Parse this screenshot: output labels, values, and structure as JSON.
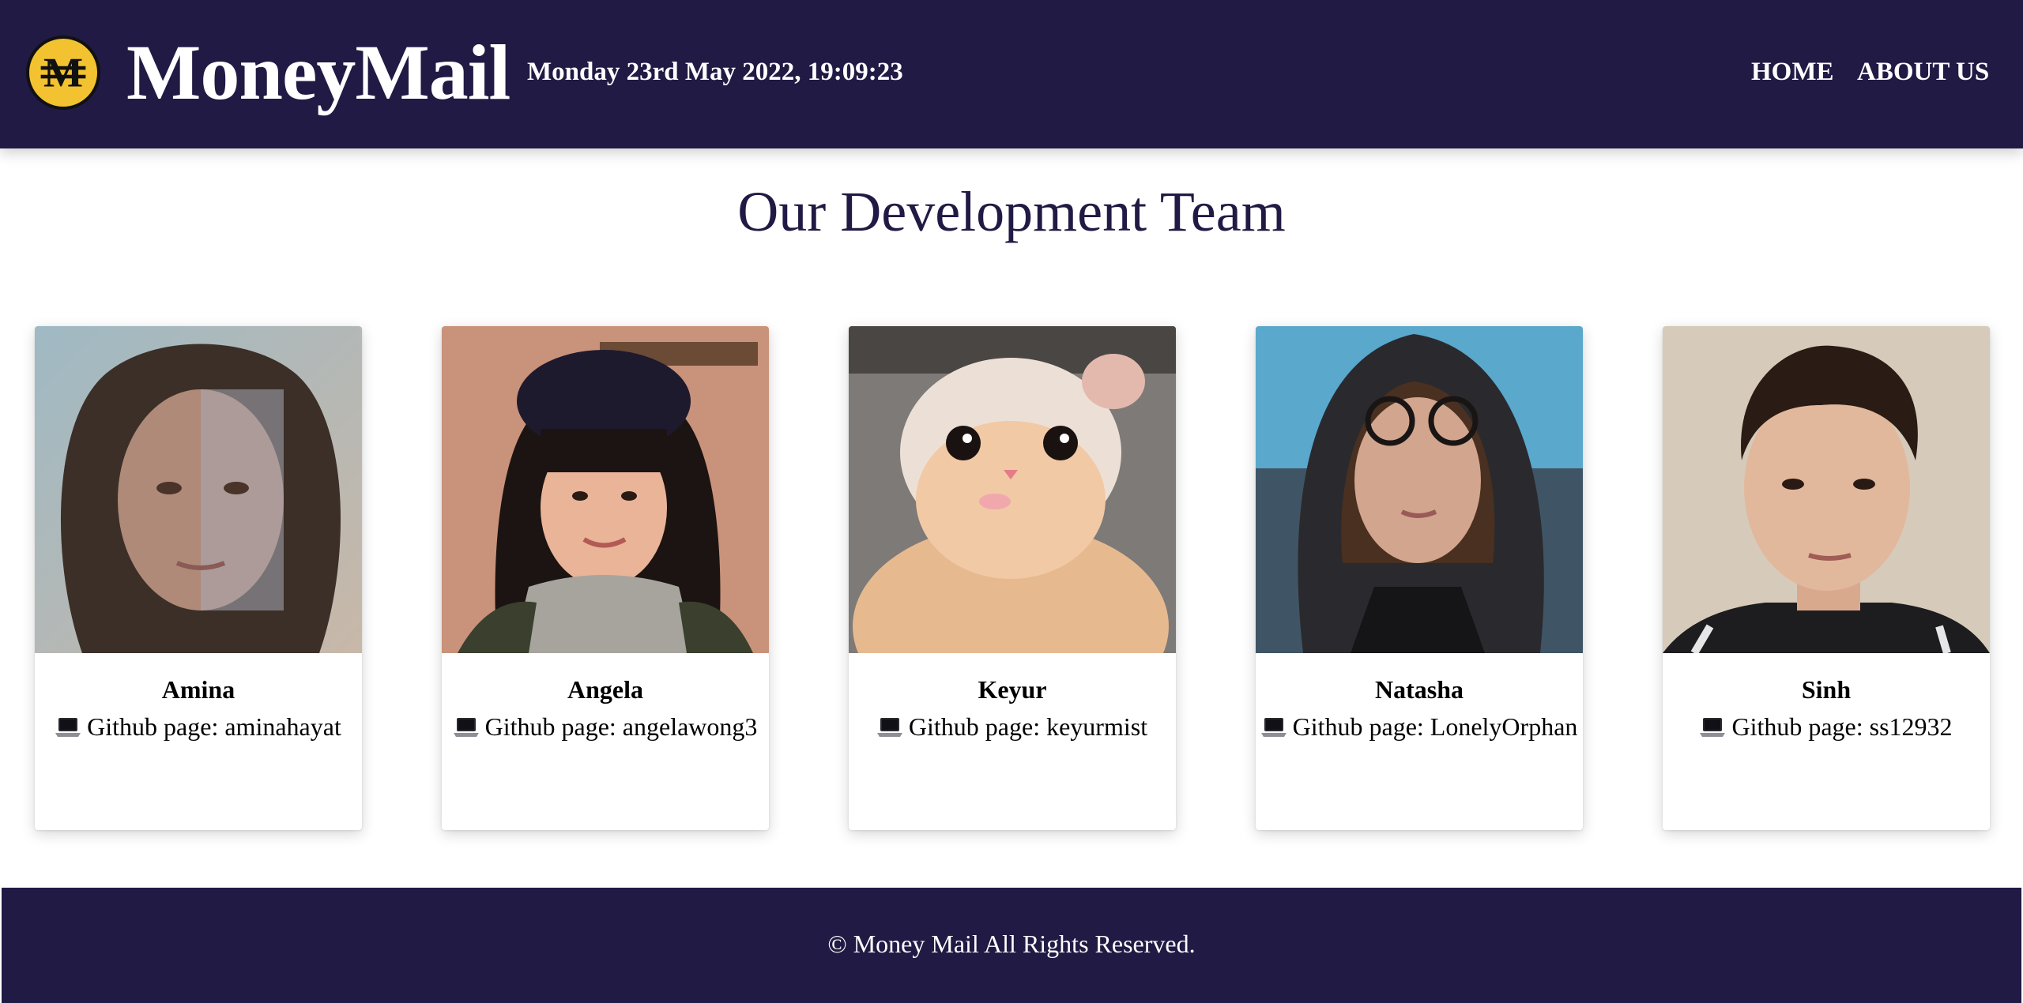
{
  "header": {
    "brand": "MoneyMail",
    "datetime": "Monday 23rd May 2022, 19:09:23",
    "logo_icon": "moneymail-coin-logo",
    "nav": [
      {
        "label": "HOME"
      },
      {
        "label": "ABOUT US"
      }
    ]
  },
  "main": {
    "title": "Our Development Team",
    "github_prefix": "Github page: ",
    "github_icon": "laptop-icon",
    "team": [
      {
        "name": "Amina",
        "github": "aminahayat"
      },
      {
        "name": "Angela",
        "github": "angelawong3"
      },
      {
        "name": "Keyur",
        "github": "keyurmist"
      },
      {
        "name": "Natasha",
        "github": "LonelyOrphan"
      },
      {
        "name": "Sinh",
        "github": "ss12932"
      }
    ]
  },
  "footer": {
    "text": "© Money Mail All Rights Reserved."
  },
  "colors": {
    "header_bg": "#211a44",
    "title_color": "#211a44",
    "logo_gold": "#f2c230"
  }
}
